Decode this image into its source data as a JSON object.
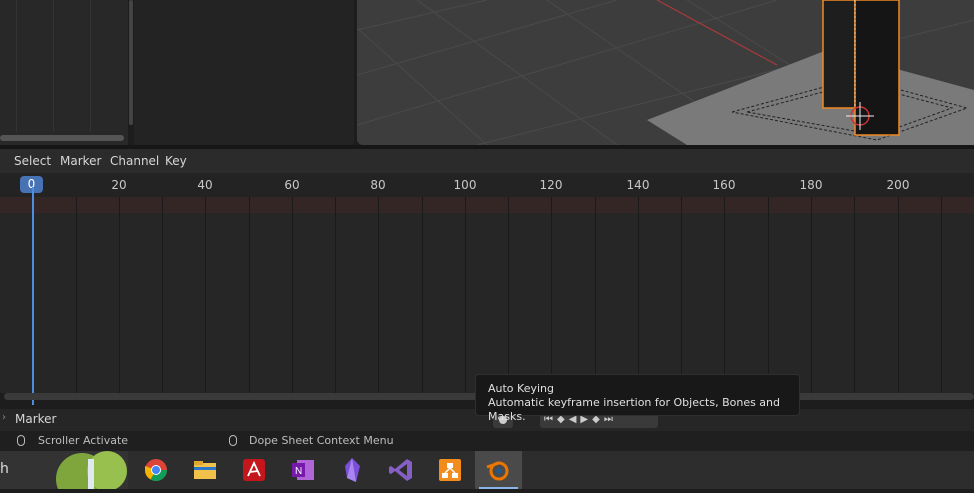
{
  "dopesheet": {
    "menus": [
      "Select",
      "Marker",
      "Channel",
      "Key"
    ],
    "current_frame": "0",
    "ticks": [
      "20",
      "40",
      "60",
      "80",
      "100",
      "120",
      "140",
      "160",
      "180",
      "200"
    ]
  },
  "bottom_bar": {
    "label": "Marker"
  },
  "status": {
    "left": "Scroller Activate",
    "right": "Dope Sheet Context Menu"
  },
  "tooltip": {
    "title": "Auto Keying",
    "description": "Automatic keyframe insertion for Objects, Bones and Masks."
  },
  "taskbar": {
    "search_fragment": "h",
    "apps": [
      "chrome-icon",
      "file-explorer-icon",
      "acrobat-icon",
      "onenote-icon",
      "obsidian-icon",
      "visual-studio-icon",
      "app-icon",
      "blender-icon"
    ]
  },
  "colors": {
    "accent": "#4772b3",
    "playhead": "#4d8ee0",
    "selection_outline": "#f08a24"
  }
}
